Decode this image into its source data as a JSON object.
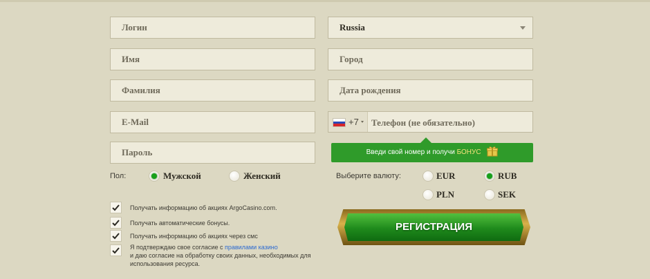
{
  "form": {
    "login_placeholder": "Логин",
    "name_placeholder": "Имя",
    "surname_placeholder": "Фамилия",
    "email_placeholder": "E-Mail",
    "password_placeholder": "Пароль",
    "country_value": "Russia",
    "city_placeholder": "Город",
    "birthdate_placeholder": "Дата рождения",
    "phone_code": "+7",
    "phone_placeholder": "Телефон (не обязательно)"
  },
  "bonus": {
    "text": "Введи свой номер и получи ",
    "accent": "БОНУС",
    "icon": "gift-icon"
  },
  "gender": {
    "label": "Пол:",
    "options": [
      {
        "label": "Мужской",
        "checked": true
      },
      {
        "label": "Женский",
        "checked": false
      }
    ]
  },
  "currency": {
    "label": "Выберите валюту:",
    "options": [
      {
        "label": "EUR",
        "checked": false
      },
      {
        "label": "RUB",
        "checked": true
      },
      {
        "label": "PLN",
        "checked": false
      },
      {
        "label": "SEK",
        "checked": false
      }
    ]
  },
  "checkboxes": [
    {
      "label": "Получать информацию об акциях ArgoCasino.com.",
      "checked": true
    },
    {
      "label": "Получать автоматические бонусы.",
      "checked": true
    },
    {
      "label": "Получать информацию об акциях через смс",
      "checked": true
    }
  ],
  "terms": {
    "prefix": "Я подтверждаю свое согласие с ",
    "link": "правилами казино",
    "line2": "и даю согласие на обработку своих данных, необходимых для",
    "line3": "использования ресурса.",
    "checked": true
  },
  "register_button": "РЕГИСТРАЦИЯ",
  "colors": {
    "background": "#dcd8c2",
    "accent_green": "#2f9b2a",
    "link_blue": "#2c6ad1"
  }
}
